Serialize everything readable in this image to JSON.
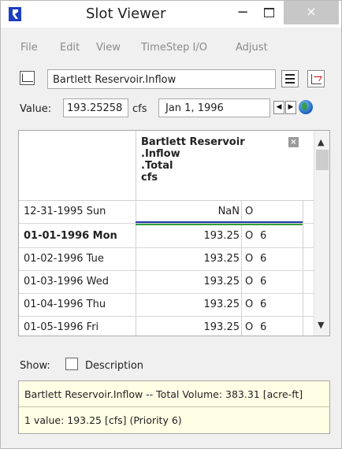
{
  "window": {
    "title": "Slot Viewer",
    "minimize": "−",
    "close": "×"
  },
  "menu": [
    "File",
    "Edit",
    "View",
    "TimeStep I/O",
    "Adjust"
  ],
  "slot": {
    "name": "Bartlett Reservoir.Inflow"
  },
  "value_row": {
    "label": "Value:",
    "value": "193.25258",
    "units": "cfs",
    "date": "Jan 1, 1996",
    "prev": "◀",
    "next": "▶"
  },
  "table": {
    "column_header": [
      "Bartlett Reservoir",
      ".Inflow",
      ".Total",
      "cfs"
    ],
    "header_close": "×",
    "rows": [
      {
        "date": "12-31-1995 Sun",
        "value": "NaN",
        "flag": "O",
        "priority": ""
      },
      {
        "date": "01-01-1996 Mon",
        "value": "193.25",
        "flag": "O",
        "priority": "6"
      },
      {
        "date": "01-02-1996 Tue",
        "value": "193.25",
        "flag": "O",
        "priority": "6"
      },
      {
        "date": "01-03-1996 Wed",
        "value": "193.25",
        "flag": "O",
        "priority": "6"
      },
      {
        "date": "01-04-1996 Thu",
        "value": "193.25",
        "flag": "O",
        "priority": "6"
      },
      {
        "date": "01-05-1996 Fri",
        "value": "193.25",
        "flag": "O",
        "priority": "6"
      }
    ],
    "scroll_up": "▲",
    "scroll_down": "▼"
  },
  "show": {
    "label": "Show:",
    "description_label": "Description"
  },
  "info": {
    "line1": "Bartlett Reservoir.Inflow -- Total Volume: 383.31 [acre-ft]",
    "line2": "1 value:  193.25 [cfs]  (Priority 6)"
  }
}
